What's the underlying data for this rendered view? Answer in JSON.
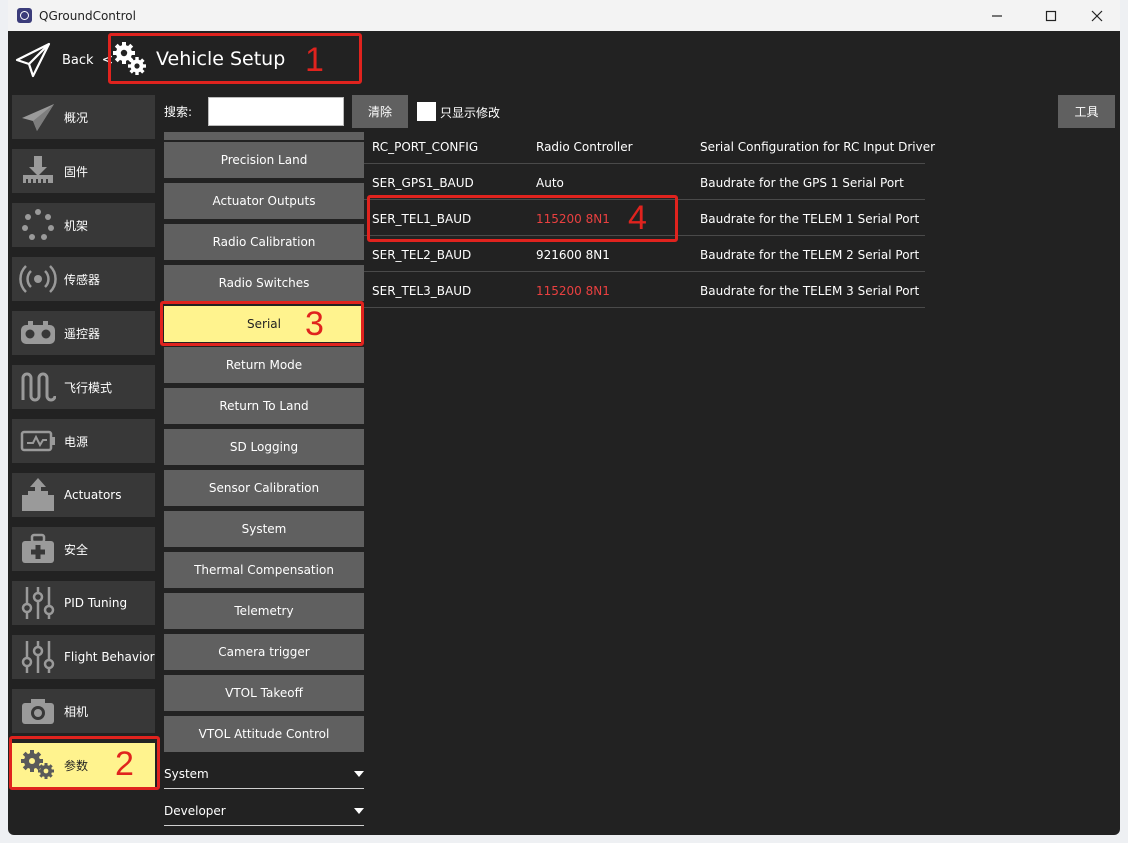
{
  "window": {
    "title": "QGroundControl"
  },
  "toolbar": {
    "back_label": "Back",
    "separator": "<",
    "page_title": "Vehicle Setup"
  },
  "nav": {
    "items": [
      {
        "label": "概况",
        "icon": "plane-icon"
      },
      {
        "label": "固件",
        "icon": "firmware-download-icon"
      },
      {
        "label": "机架",
        "icon": "airframe-icon"
      },
      {
        "label": "传感器",
        "icon": "sensor-icon"
      },
      {
        "label": "遥控器",
        "icon": "radio-icon"
      },
      {
        "label": "飞行模式",
        "icon": "flight-mode-icon"
      },
      {
        "label": "电源",
        "icon": "battery-icon"
      },
      {
        "label": "Actuators",
        "icon": "actuator-icon"
      },
      {
        "label": "安全",
        "icon": "safety-kit-icon"
      },
      {
        "label": "PID Tuning",
        "icon": "sliders-icon"
      },
      {
        "label": "Flight Behavior",
        "icon": "sliders-icon"
      },
      {
        "label": "相机",
        "icon": "camera-icon"
      },
      {
        "label": "参数",
        "icon": "gears-icon"
      }
    ]
  },
  "search": {
    "label": "搜索:",
    "value": "",
    "clear_label": "清除",
    "changed_only_label": "只显示修改"
  },
  "tools_label": "工具",
  "groups": [
    "Precision Land",
    "Actuator Outputs",
    "Radio Calibration",
    "Radio Switches",
    "Serial",
    "Return Mode",
    "Return To Land",
    "SD Logging",
    "Sensor Calibration",
    "System",
    "Thermal Compensation",
    "Telemetry",
    "Camera trigger",
    "VTOL Takeoff",
    "VTOL Attitude Control"
  ],
  "categories": [
    "System",
    "Developer"
  ],
  "params": [
    {
      "name": "RC_PORT_CONFIG",
      "value": "Radio Controller",
      "desc": "Serial Configuration for RC Input Driver",
      "modified": false
    },
    {
      "name": "SER_GPS1_BAUD",
      "value": "Auto",
      "desc": "Baudrate for the GPS 1 Serial Port",
      "modified": false
    },
    {
      "name": "SER_TEL1_BAUD",
      "value": "115200 8N1",
      "desc": "Baudrate for the TELEM 1 Serial Port",
      "modified": true
    },
    {
      "name": "SER_TEL2_BAUD",
      "value": "921600 8N1",
      "desc": "Baudrate for the TELEM 2 Serial Port",
      "modified": false
    },
    {
      "name": "SER_TEL3_BAUD",
      "value": "115200 8N1",
      "desc": "Baudrate for the TELEM 3 Serial Port",
      "modified": true
    }
  ],
  "annotations": [
    "1",
    "2",
    "3",
    "4"
  ],
  "colors": {
    "highlight": "#fff38e",
    "annotation": "#e0231e",
    "modified_value": "#e94040"
  }
}
